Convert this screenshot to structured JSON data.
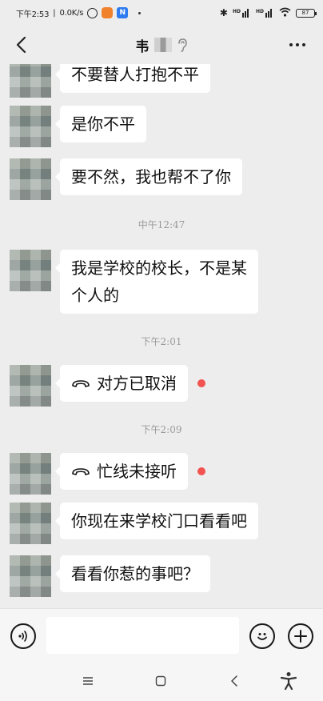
{
  "status_bar": {
    "time": "下午2:53",
    "network_speed": "0.0K/s",
    "app2_label": "N",
    "battery": "87"
  },
  "header": {
    "title": "韦"
  },
  "messages": [
    {
      "type": "text",
      "text": "不要替人打抱不平"
    },
    {
      "type": "text",
      "text": "是你不平"
    },
    {
      "type": "text",
      "text": "要不然，我也帮不了你"
    },
    {
      "type": "timestamp",
      "text": "中午12:47"
    },
    {
      "type": "text",
      "lines": [
        "我是学校的校长，不是某",
        "个人的"
      ]
    },
    {
      "type": "timestamp",
      "text": "下午2:01"
    },
    {
      "type": "call",
      "text": "对方已取消",
      "icon": "phone-hangup-icon",
      "unread": true
    },
    {
      "type": "timestamp",
      "text": "下午2:09"
    },
    {
      "type": "call",
      "text": "忙线未接听",
      "icon": "phone-hangup-icon",
      "unread": true
    },
    {
      "type": "text",
      "text": "你现在来学校门口看看吧"
    },
    {
      "type": "text",
      "text": "看看你惹的事吧？"
    }
  ],
  "input_bar": {
    "placeholder": ""
  },
  "colors": {
    "background": "#ededed",
    "bubble": "#ffffff",
    "unread_dot": "#f25350",
    "timestamp": "#9a9a9a"
  }
}
